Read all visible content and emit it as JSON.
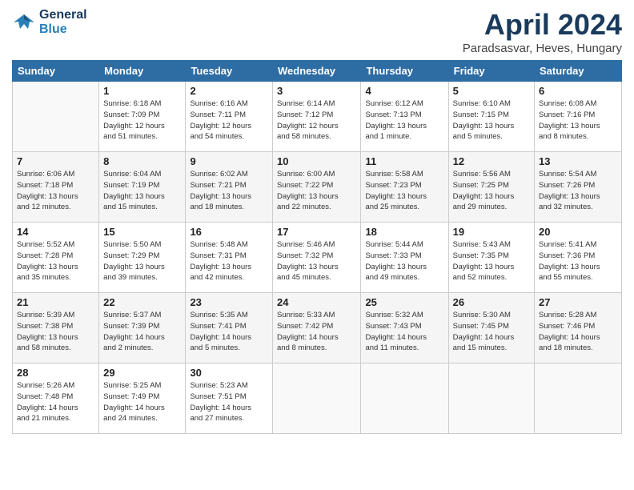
{
  "header": {
    "logo_line1": "General",
    "logo_line2": "Blue",
    "title": "April 2024",
    "subtitle": "Paradsasvar, Heves, Hungary"
  },
  "days_of_week": [
    "Sunday",
    "Monday",
    "Tuesday",
    "Wednesday",
    "Thursday",
    "Friday",
    "Saturday"
  ],
  "weeks": [
    [
      {
        "day": "",
        "info": ""
      },
      {
        "day": "1",
        "info": "Sunrise: 6:18 AM\nSunset: 7:09 PM\nDaylight: 12 hours\nand 51 minutes."
      },
      {
        "day": "2",
        "info": "Sunrise: 6:16 AM\nSunset: 7:11 PM\nDaylight: 12 hours\nand 54 minutes."
      },
      {
        "day": "3",
        "info": "Sunrise: 6:14 AM\nSunset: 7:12 PM\nDaylight: 12 hours\nand 58 minutes."
      },
      {
        "day": "4",
        "info": "Sunrise: 6:12 AM\nSunset: 7:13 PM\nDaylight: 13 hours\nand 1 minute."
      },
      {
        "day": "5",
        "info": "Sunrise: 6:10 AM\nSunset: 7:15 PM\nDaylight: 13 hours\nand 5 minutes."
      },
      {
        "day": "6",
        "info": "Sunrise: 6:08 AM\nSunset: 7:16 PM\nDaylight: 13 hours\nand 8 minutes."
      }
    ],
    [
      {
        "day": "7",
        "info": "Sunrise: 6:06 AM\nSunset: 7:18 PM\nDaylight: 13 hours\nand 12 minutes."
      },
      {
        "day": "8",
        "info": "Sunrise: 6:04 AM\nSunset: 7:19 PM\nDaylight: 13 hours\nand 15 minutes."
      },
      {
        "day": "9",
        "info": "Sunrise: 6:02 AM\nSunset: 7:21 PM\nDaylight: 13 hours\nand 18 minutes."
      },
      {
        "day": "10",
        "info": "Sunrise: 6:00 AM\nSunset: 7:22 PM\nDaylight: 13 hours\nand 22 minutes."
      },
      {
        "day": "11",
        "info": "Sunrise: 5:58 AM\nSunset: 7:23 PM\nDaylight: 13 hours\nand 25 minutes."
      },
      {
        "day": "12",
        "info": "Sunrise: 5:56 AM\nSunset: 7:25 PM\nDaylight: 13 hours\nand 29 minutes."
      },
      {
        "day": "13",
        "info": "Sunrise: 5:54 AM\nSunset: 7:26 PM\nDaylight: 13 hours\nand 32 minutes."
      }
    ],
    [
      {
        "day": "14",
        "info": "Sunrise: 5:52 AM\nSunset: 7:28 PM\nDaylight: 13 hours\nand 35 minutes."
      },
      {
        "day": "15",
        "info": "Sunrise: 5:50 AM\nSunset: 7:29 PM\nDaylight: 13 hours\nand 39 minutes."
      },
      {
        "day": "16",
        "info": "Sunrise: 5:48 AM\nSunset: 7:31 PM\nDaylight: 13 hours\nand 42 minutes."
      },
      {
        "day": "17",
        "info": "Sunrise: 5:46 AM\nSunset: 7:32 PM\nDaylight: 13 hours\nand 45 minutes."
      },
      {
        "day": "18",
        "info": "Sunrise: 5:44 AM\nSunset: 7:33 PM\nDaylight: 13 hours\nand 49 minutes."
      },
      {
        "day": "19",
        "info": "Sunrise: 5:43 AM\nSunset: 7:35 PM\nDaylight: 13 hours\nand 52 minutes."
      },
      {
        "day": "20",
        "info": "Sunrise: 5:41 AM\nSunset: 7:36 PM\nDaylight: 13 hours\nand 55 minutes."
      }
    ],
    [
      {
        "day": "21",
        "info": "Sunrise: 5:39 AM\nSunset: 7:38 PM\nDaylight: 13 hours\nand 58 minutes."
      },
      {
        "day": "22",
        "info": "Sunrise: 5:37 AM\nSunset: 7:39 PM\nDaylight: 14 hours\nand 2 minutes."
      },
      {
        "day": "23",
        "info": "Sunrise: 5:35 AM\nSunset: 7:41 PM\nDaylight: 14 hours\nand 5 minutes."
      },
      {
        "day": "24",
        "info": "Sunrise: 5:33 AM\nSunset: 7:42 PM\nDaylight: 14 hours\nand 8 minutes."
      },
      {
        "day": "25",
        "info": "Sunrise: 5:32 AM\nSunset: 7:43 PM\nDaylight: 14 hours\nand 11 minutes."
      },
      {
        "day": "26",
        "info": "Sunrise: 5:30 AM\nSunset: 7:45 PM\nDaylight: 14 hours\nand 15 minutes."
      },
      {
        "day": "27",
        "info": "Sunrise: 5:28 AM\nSunset: 7:46 PM\nDaylight: 14 hours\nand 18 minutes."
      }
    ],
    [
      {
        "day": "28",
        "info": "Sunrise: 5:26 AM\nSunset: 7:48 PM\nDaylight: 14 hours\nand 21 minutes."
      },
      {
        "day": "29",
        "info": "Sunrise: 5:25 AM\nSunset: 7:49 PM\nDaylight: 14 hours\nand 24 minutes."
      },
      {
        "day": "30",
        "info": "Sunrise: 5:23 AM\nSunset: 7:51 PM\nDaylight: 14 hours\nand 27 minutes."
      },
      {
        "day": "",
        "info": ""
      },
      {
        "day": "",
        "info": ""
      },
      {
        "day": "",
        "info": ""
      },
      {
        "day": "",
        "info": ""
      }
    ]
  ]
}
